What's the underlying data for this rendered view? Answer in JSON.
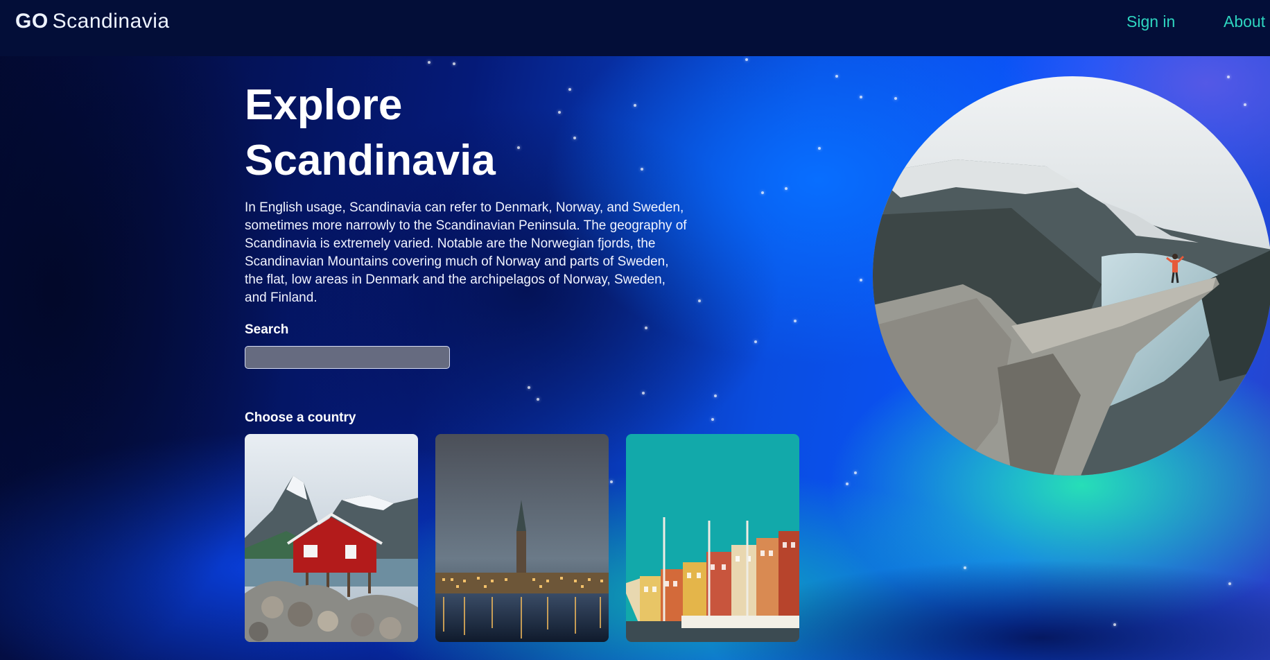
{
  "header": {
    "logo_bold": "GO",
    "logo_text": "Scandinavia",
    "nav": {
      "signin": "Sign in",
      "about": "About"
    }
  },
  "hero": {
    "title_line1": "Explore",
    "title_line2": "Scandinavia",
    "description": "In English usage, Scandinavia can refer to Denmark, Norway, and Sweden, sometimes more narrowly to the Scandinavian Peninsula. The geography of Scandinavia is extremely varied. Notable are the Norwegian fjords, the Scandinavian Mountains covering much of Norway and parts of Sweden, the flat, low areas in Denmark and the archipelagos of Norway, Sweden, and Finland."
  },
  "search": {
    "label": "Search",
    "value": ""
  },
  "countries": {
    "heading": "Choose a country"
  },
  "colors": {
    "header_bg": "#030e38",
    "nav_link": "#2ed5c0",
    "text": "#ffffff"
  }
}
